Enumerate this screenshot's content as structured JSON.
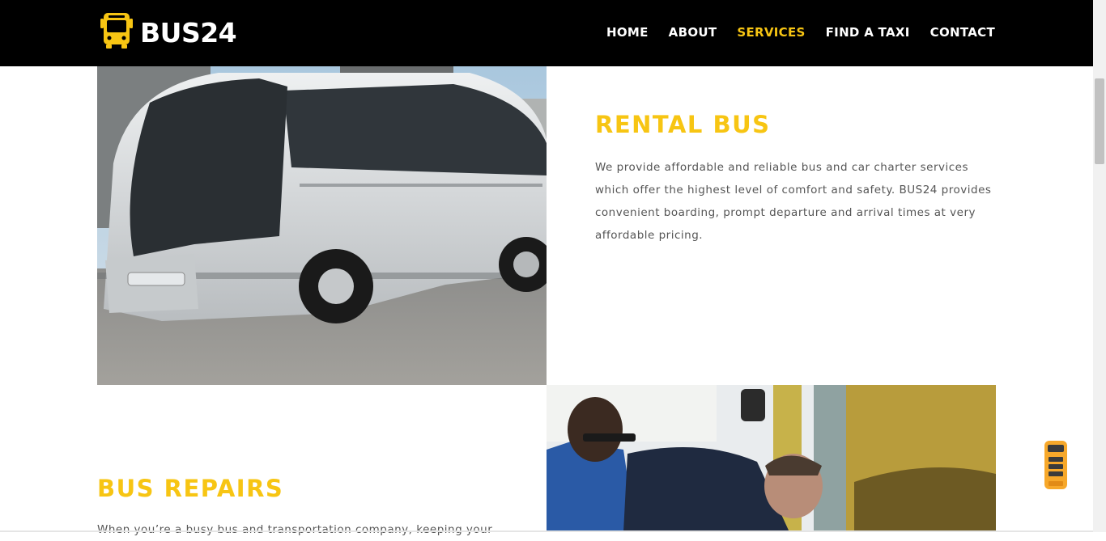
{
  "header": {
    "logo_text": "BUS24",
    "logo_icon": "bus-icon",
    "nav": [
      {
        "label": "HOME",
        "active": false
      },
      {
        "label": "ABOUT",
        "active": false
      },
      {
        "label": "SERVICES",
        "active": true
      },
      {
        "label": "FIND A TAXI",
        "active": false
      },
      {
        "label": "CONTACT",
        "active": false
      }
    ]
  },
  "sections": {
    "rental": {
      "title": "RENTAL BUS",
      "text": "We provide affordable and reliable bus and car charter services which offer the highest level of comfort and safety. BUS24 provides convenient boarding, prompt departure and arrival times at very affordable pricing."
    },
    "repairs": {
      "title": "BUS REPAIRS",
      "text": "When you’re a busy bus and transportation company, keeping your"
    }
  },
  "floating_button": {
    "icon": "bus-icon"
  },
  "colors": {
    "accent": "#f7c513",
    "header_bg": "#000000",
    "nav_text": "#ffffff",
    "body_text": "#555555"
  }
}
